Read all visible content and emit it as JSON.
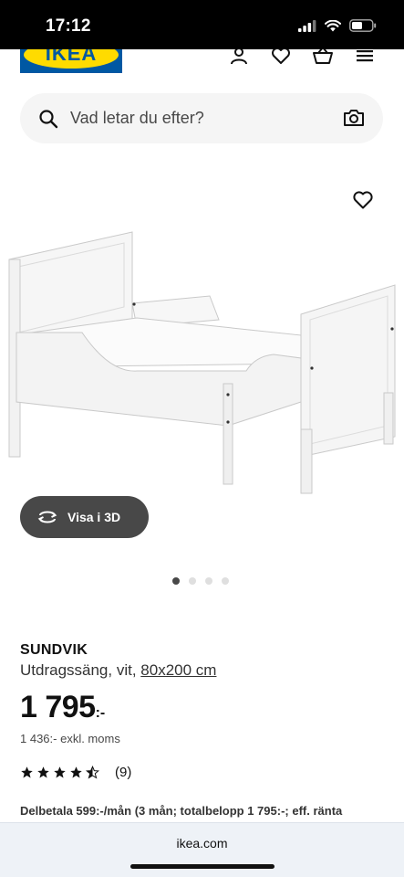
{
  "status_bar": {
    "time": "17:12"
  },
  "header": {
    "logo_text": "IKEA",
    "brand_color": "#0058a3",
    "logo_yellow": "#ffdb00"
  },
  "search": {
    "placeholder": "Vad letar du efter?"
  },
  "icons": {
    "header": [
      "user-icon",
      "heart-icon",
      "basket-icon",
      "menu-icon"
    ],
    "search": "search-icon",
    "camera": "camera-icon",
    "favourite": "heart-icon",
    "view3d": "rotate-icon"
  },
  "gallery": {
    "view3d_label": "Visa i 3D",
    "image_count": 4,
    "active_index": 0
  },
  "product": {
    "name": "SUNDVIK",
    "description": "Utdragssäng, vit, ",
    "size": "80x200 cm",
    "price": "1 795",
    "price_suffix": ":-",
    "price_ex_vat": "1 436:- exkl. moms",
    "rating": 4.5,
    "rating_count": "(9)",
    "installment": "Delbetala 599:-/mån (3 mån; totalbelopp 1 795:-; eff. ränta"
  },
  "browser": {
    "url": "ikea.com"
  }
}
